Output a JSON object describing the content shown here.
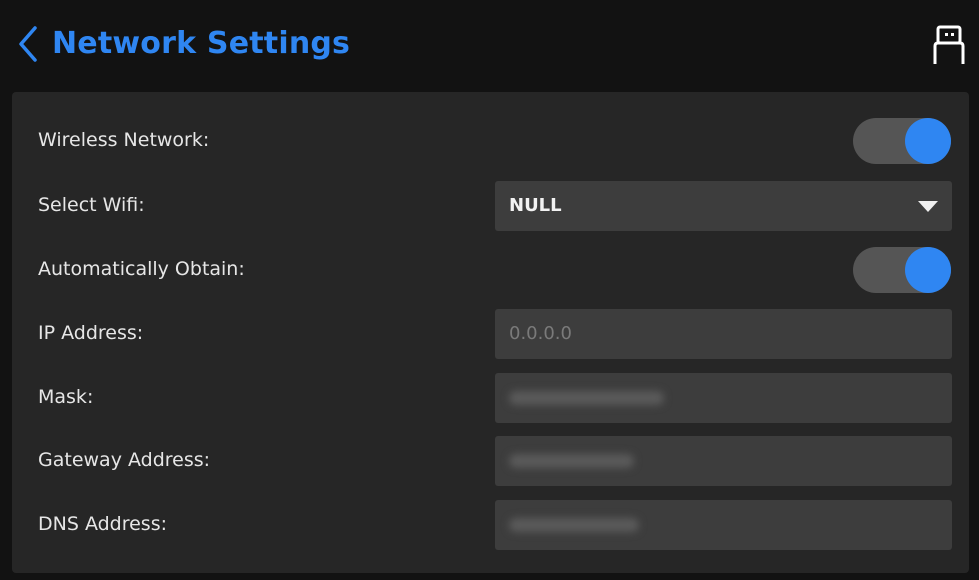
{
  "header": {
    "title": "Network Settings"
  },
  "settings": {
    "wireless": {
      "label": "Wireless Network:",
      "enabled": true
    },
    "wifi": {
      "label": "Select Wifi:",
      "value": "NULL"
    },
    "auto_obtain": {
      "label": "Automatically Obtain:",
      "enabled": true
    },
    "ip": {
      "label": "IP Address:",
      "placeholder": "0.0.0.0"
    },
    "mask": {
      "label": "Mask:"
    },
    "gateway": {
      "label": "Gateway Address:"
    },
    "dns": {
      "label": "DNS Address:"
    }
  },
  "colors": {
    "accent": "#2f86f2",
    "panel": "#262626",
    "field": "#3d3d3d",
    "toggle_track": "#555555"
  },
  "icons": {
    "back": "chevron-left-icon",
    "device": "usb-device-icon"
  }
}
